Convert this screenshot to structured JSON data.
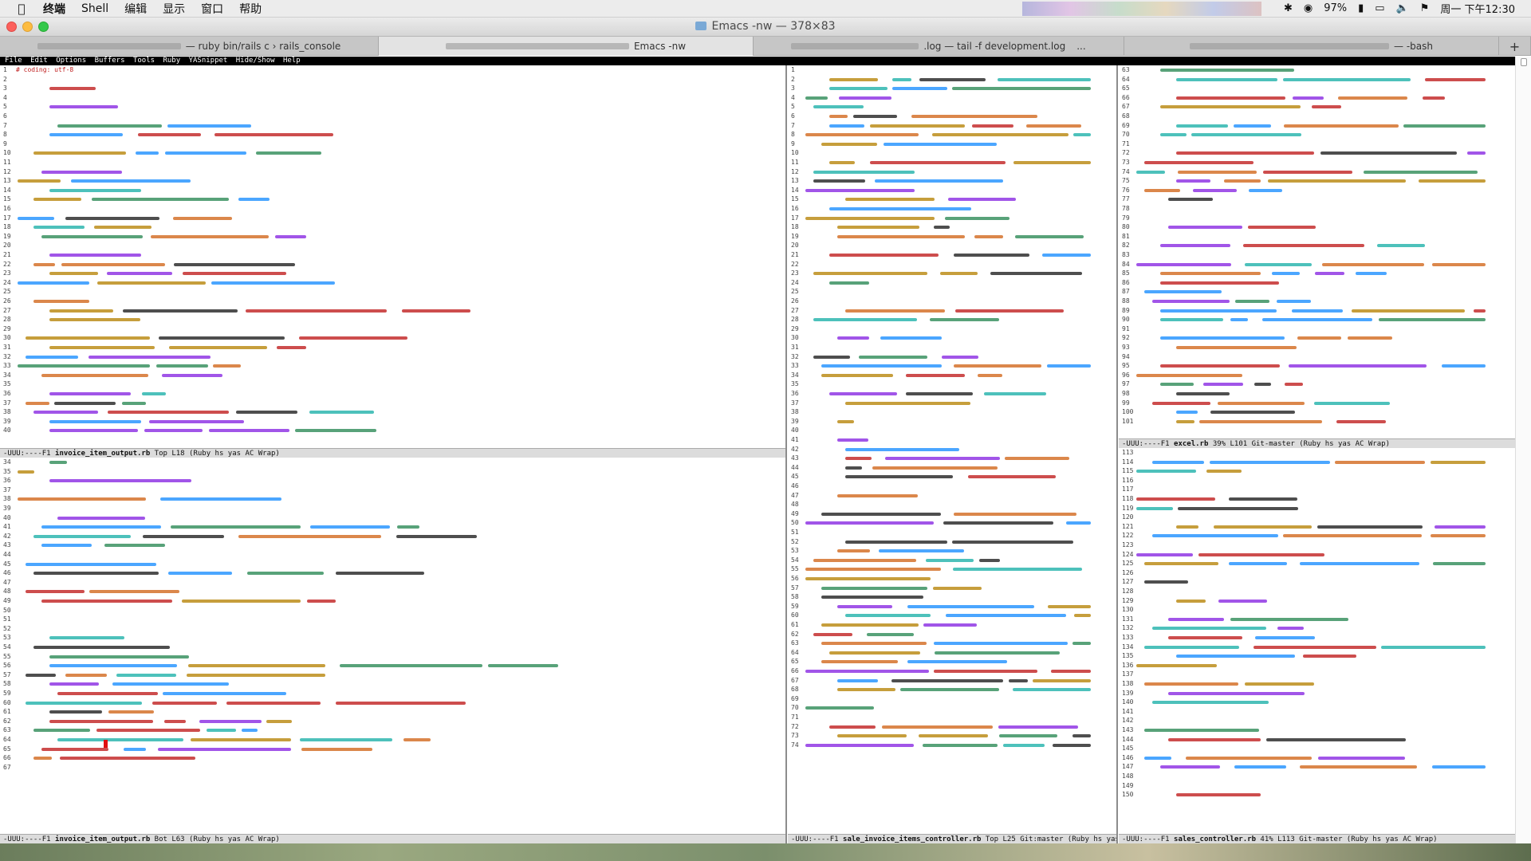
{
  "menubar": {
    "app_name": "终端",
    "items": [
      "Shell",
      "编辑",
      "显示",
      "窗口",
      "帮助"
    ],
    "battery": "97%",
    "clock": "周一 下午12:30"
  },
  "window": {
    "title": "Emacs -nw — 378×83"
  },
  "tabs": [
    {
      "label": "— ruby bin/rails c › rails_console",
      "active": false
    },
    {
      "label": "Emacs -nw",
      "active": true
    },
    {
      "label": ".log — tail -f development.log",
      "active": false
    },
    {
      "label": "— -bash",
      "active": false
    }
  ],
  "tab_overflow": "...",
  "tab_add": "+",
  "emacs_menu": [
    "File",
    "Edit",
    "Options",
    "Buffers",
    "Tools",
    "Ruby",
    "YASnippet",
    "Hide/Show",
    "Help"
  ],
  "panes": {
    "top_left": {
      "first_line_text": "# coding: utf-8",
      "line_start": 1,
      "line_count": 40,
      "modeline": {
        "prefix": "-UUU:----F1",
        "buffer": "invoice_item_output.rb",
        "position": "Top L18",
        "modes": "(Ruby hs yas AC Wrap)"
      }
    },
    "bottom_left": {
      "line_start": 34,
      "line_count": 34,
      "modeline": {
        "prefix": "-UUU:----F1",
        "buffer": "invoice_item_output.rb",
        "position": "Bot L63",
        "modes": "(Ruby hs yas AC Wrap)"
      }
    },
    "middle": {
      "line_start": 1,
      "line_count": 74,
      "modeline": {
        "prefix": "-UUU:----F1",
        "buffer": "sale_invoice_items_controller.rb",
        "position": "Top L25",
        "modes": "Git:master (Ruby hs yas"
      }
    },
    "top_right": {
      "line_start": 63,
      "line_count": 39,
      "modeline": {
        "prefix": "-UUU:----F1",
        "buffer": "excel.rb",
        "position": "39% L101",
        "modes": "Git-master (Ruby hs yas AC Wrap)"
      }
    },
    "bottom_right": {
      "line_start": 113,
      "line_count": 38,
      "modeline": {
        "prefix": "-UUU:----F1",
        "buffer": "sales_controller.rb",
        "position": "41% L113",
        "modes": "Git-master (Ruby hs yas AC Wrap)"
      }
    }
  },
  "syntax_colors": [
    "#c02020",
    "#8a2be2",
    "#2e8b57",
    "#1e90ff",
    "#222222",
    "#d2691e",
    "#b8860b",
    "#20b2aa"
  ]
}
